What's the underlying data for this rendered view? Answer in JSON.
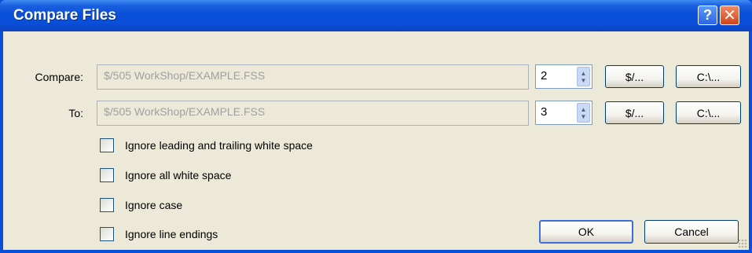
{
  "window": {
    "title": "Compare Files",
    "help_glyph": "?",
    "close_glyph": "✕"
  },
  "compare": {
    "label": "Compare:",
    "path": "$/505 WorkShop/EXAMPLE.FSS",
    "version": "2",
    "vss_button": "$/...",
    "local_button": "C:\\..."
  },
  "to": {
    "label": "To:",
    "path": "$/505 WorkShop/EXAMPLE.FSS",
    "version": "3",
    "vss_button": "$/...",
    "local_button": "C:\\..."
  },
  "options": [
    {
      "label": "Ignore leading and trailing white space",
      "checked": false
    },
    {
      "label": "Ignore all white space",
      "checked": false
    },
    {
      "label": "Ignore case",
      "checked": false
    },
    {
      "label": "Ignore line endings",
      "checked": false
    }
  ],
  "buttons": {
    "ok": "OK",
    "cancel": "Cancel"
  },
  "icons": {
    "help": "help-icon",
    "close": "close-icon",
    "spinner": "spinner-arrows-icon",
    "grip": "resize-grip-icon"
  }
}
